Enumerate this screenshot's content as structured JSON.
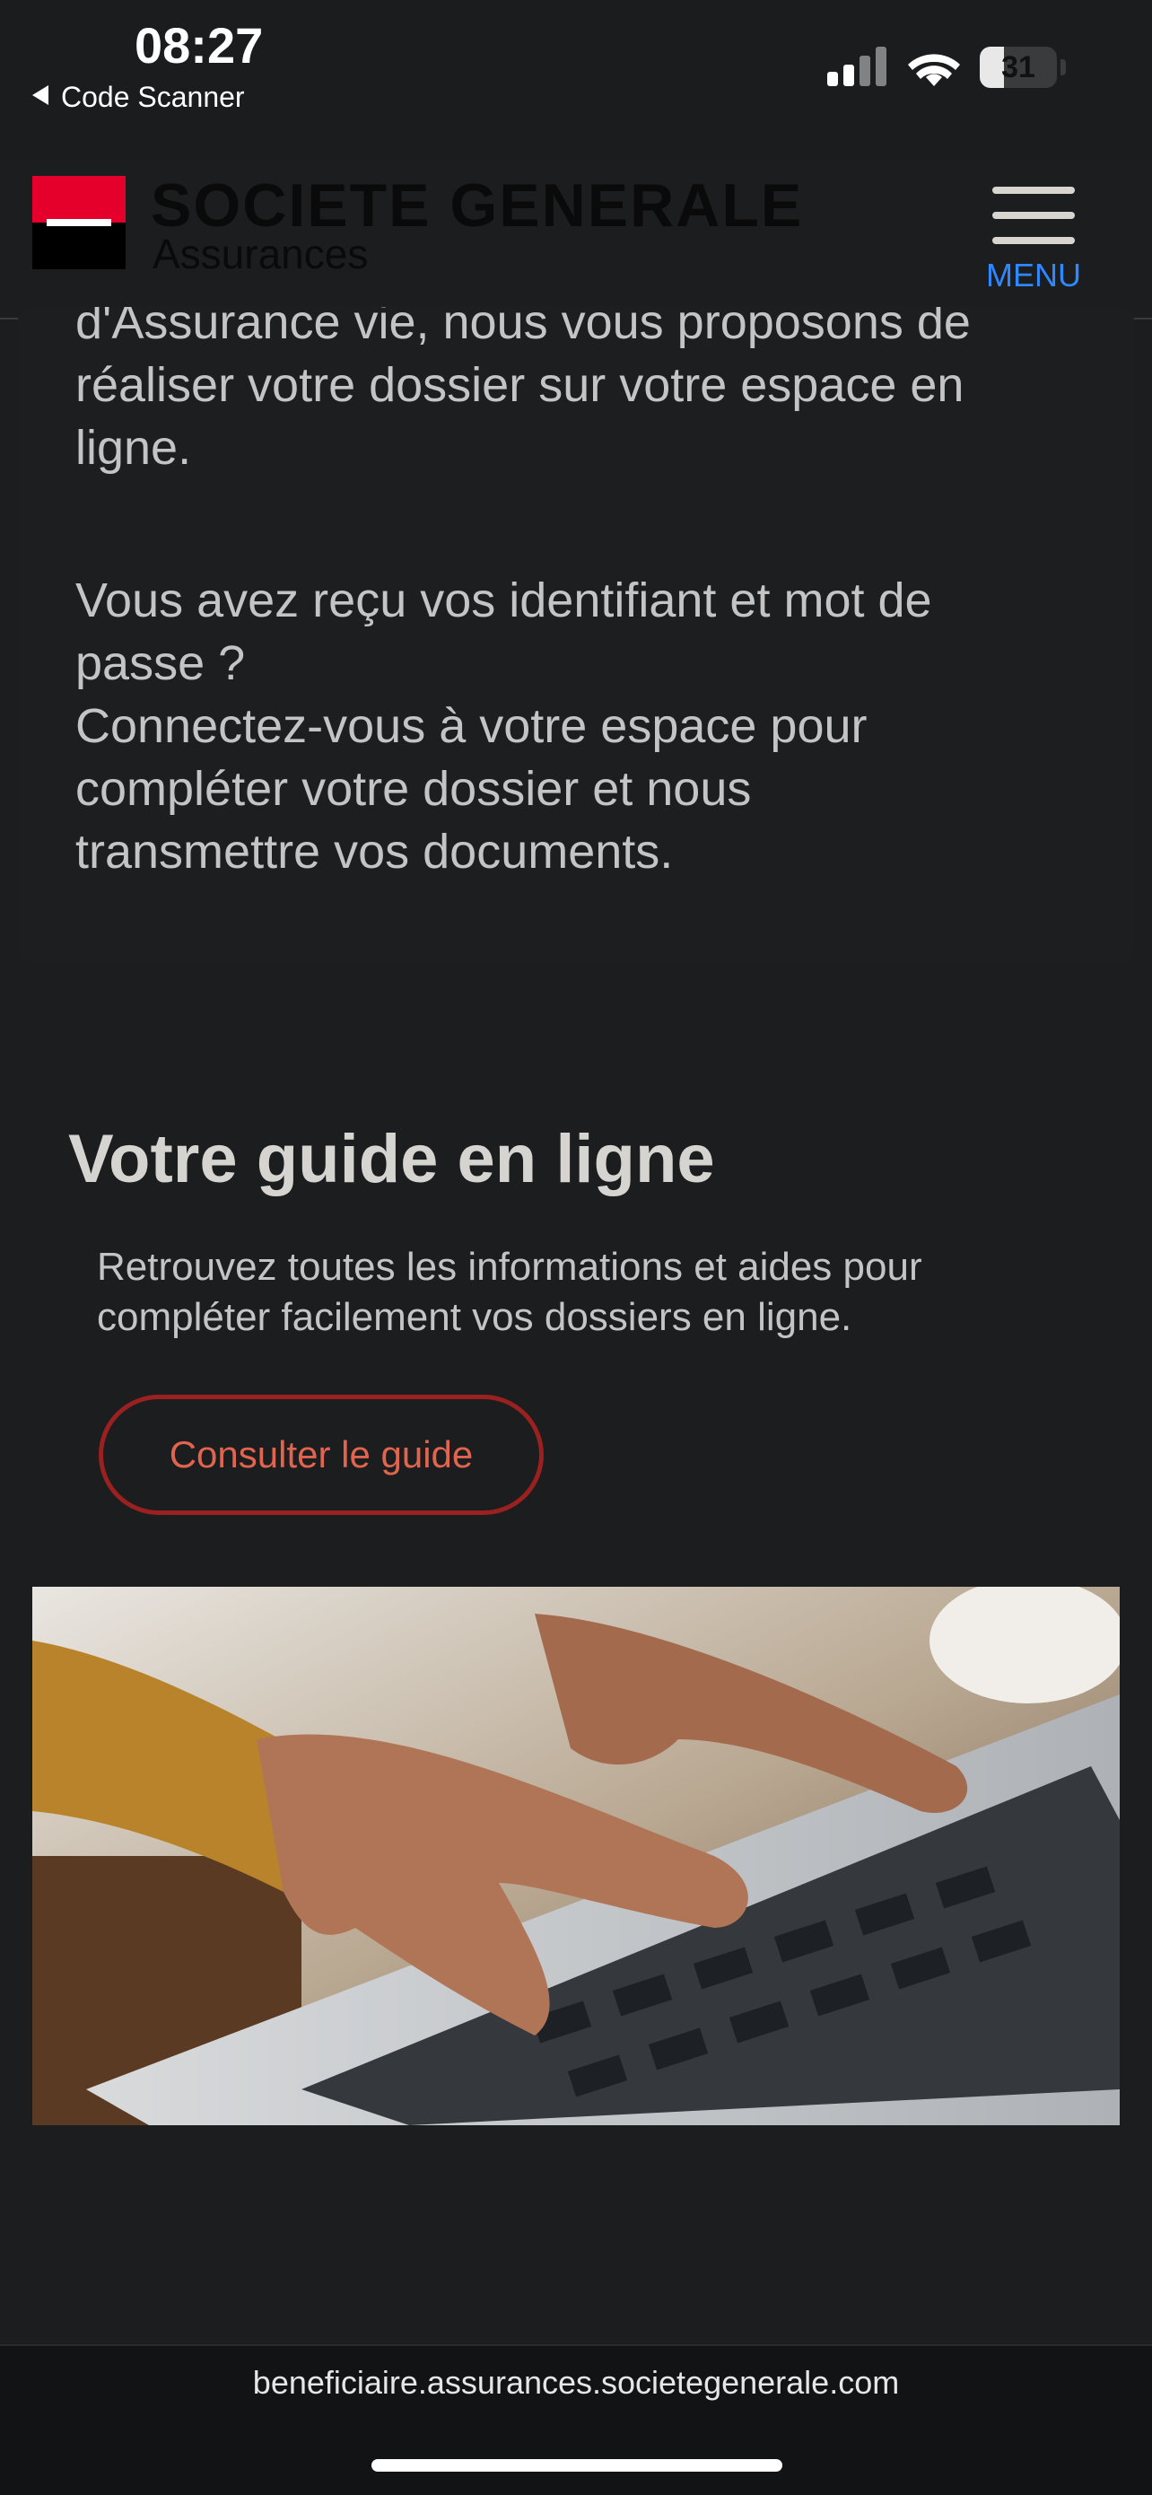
{
  "status_bar": {
    "time": "08:27",
    "back_app": "Code Scanner",
    "battery": "31",
    "battery_level": 0.31
  },
  "header": {
    "brand_name": "SOCIETE GENERALE",
    "brand_sub": "Assurances",
    "menu_label": "MENU"
  },
  "intro": {
    "lines_a": [
      "d'Assurance vie, nous vous proposons de",
      "réaliser votre dossier sur votre espace en",
      "ligne."
    ],
    "lines_b": [
      "Vous avez reçu vos identifiant et mot de",
      "passe ?",
      "Connectez-vous à votre espace pour",
      "compléter votre dossier et nous",
      "transmettre vos documents."
    ]
  },
  "guide": {
    "title": "Votre guide en ligne",
    "description_1": "Retrouvez toutes les informations et aides pour",
    "description_2": "compléter facilement vos dossiers en ligne.",
    "button_label": "Consulter le guide"
  },
  "browser": {
    "url": "beneficiaire.assurances.societegenerale.com"
  },
  "colors": {
    "accent_red": "#e4002b",
    "button_border": "#9b2020",
    "button_text": "#e0644e",
    "menu_blue": "#2f88ff"
  }
}
